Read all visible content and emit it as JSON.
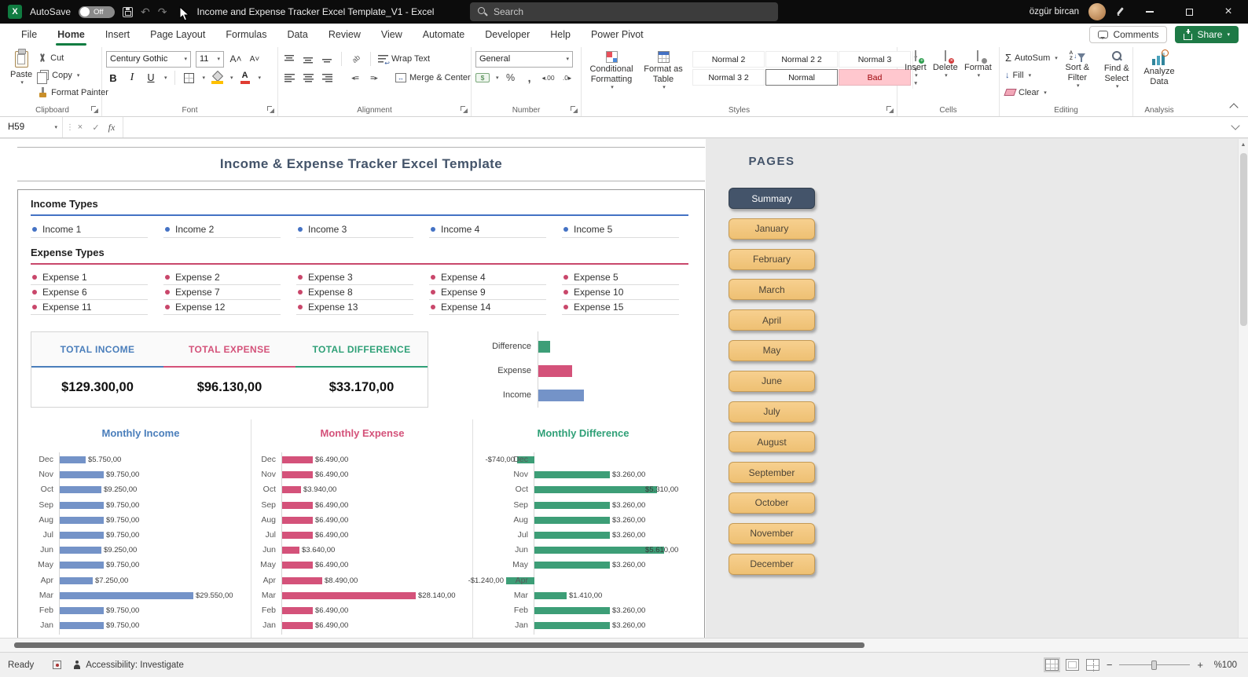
{
  "titlebar": {
    "autosave_label": "AutoSave",
    "autosave_state": "Off",
    "doc_title": "Income and Expense Tracker Excel Template_V1 - Excel",
    "search_placeholder": "Search",
    "user_name": "özgür bircan"
  },
  "icons": {
    "bold": "B",
    "italic": "I",
    "underline": "U",
    "autosum": "Σ",
    "percent": "%",
    "comma": ",",
    "inc_decimal": "◂.00",
    "dec_decimal": ".0▸"
  },
  "ribbon": {
    "tabs": [
      "File",
      "Home",
      "Insert",
      "Page Layout",
      "Formulas",
      "Data",
      "Review",
      "View",
      "Automate",
      "Developer",
      "Help",
      "Power Pivot"
    ],
    "active_tab": "Home",
    "comments_label": "Comments",
    "share_label": "Share",
    "groups": {
      "clipboard": {
        "label": "Clipboard",
        "paste": "Paste",
        "cut": "Cut",
        "copy": "Copy",
        "format_painter": "Format Painter"
      },
      "font": {
        "label": "Font",
        "font_name": "Century Gothic",
        "font_size": "11"
      },
      "alignment": {
        "label": "Alignment",
        "wrap_text": "Wrap Text",
        "merge_center": "Merge & Center"
      },
      "number": {
        "label": "Number",
        "format": "General"
      },
      "styles": {
        "label": "Styles",
        "conditional_formatting": "Conditional Formatting",
        "format_as_table": "Format as Table",
        "gallery": [
          {
            "name": "Normal 2",
            "kind": "plain"
          },
          {
            "name": "Normal 2 2",
            "kind": "plain"
          },
          {
            "name": "Normal 3",
            "kind": "plain"
          },
          {
            "name": "Normal 3 2",
            "kind": "plain"
          },
          {
            "name": "Normal",
            "kind": "selected"
          },
          {
            "name": "Bad",
            "kind": "bad"
          }
        ]
      },
      "cells": {
        "label": "Cells",
        "insert": "Insert",
        "delete": "Delete",
        "format": "Format"
      },
      "editing": {
        "label": "Editing",
        "autosum": "AutoSum",
        "fill": "Fill",
        "clear": "Clear",
        "sort_filter": "Sort & Filter",
        "find_select": "Find & Select"
      },
      "analysis": {
        "label": "Analysis",
        "analyze_data": "Analyze Data"
      }
    }
  },
  "formula_bar": {
    "name_box": "H59",
    "fx": "fx"
  },
  "sheet": {
    "page_title": "Income & Expense Tracker Excel Template",
    "income_heading": "Income Types",
    "income_types": [
      "Income 1",
      "Income 2",
      "Income 3",
      "Income 4",
      "Income 5"
    ],
    "expense_heading": "Expense Types",
    "expense_types": [
      "Expense 1",
      "Expense 2",
      "Expense 3",
      "Expense 4",
      "Expense 5",
      "Expense 6",
      "Expense 7",
      "Expense 8",
      "Expense 9",
      "Expense 10",
      "Expense 11",
      "Expense 12",
      "Expense 13",
      "Expense 14",
      "Expense 15"
    ],
    "summary": {
      "headers": [
        "TOTAL INCOME",
        "TOTAL EXPENSE",
        "TOTAL DIFFERENCE"
      ],
      "header_colors": [
        "#4A7EBB",
        "#D4527A",
        "#2FA077"
      ],
      "values": [
        "$129.300,00",
        "$96.130,00",
        "$33.170,00"
      ]
    }
  },
  "chart_data": [
    {
      "id": "totals",
      "type": "bar",
      "orientation": "horizontal",
      "title": "",
      "categories": [
        "Difference",
        "Expense",
        "Income"
      ],
      "values": [
        33170,
        96130,
        129300
      ],
      "colors": [
        "#3D9E77",
        "#D4527A",
        "#7493C8"
      ],
      "max": 129300,
      "grid": false,
      "legend": "none"
    },
    {
      "id": "monthly_income",
      "type": "bar",
      "orientation": "horizontal",
      "title": "Monthly Income",
      "title_color": "#4A7EBB",
      "color": "#7493C8",
      "categories": [
        "Dec",
        "Nov",
        "Oct",
        "Sep",
        "Aug",
        "Jul",
        "Jun",
        "May",
        "Apr",
        "Mar",
        "Feb",
        "Jan"
      ],
      "values": [
        5750,
        9750,
        9250,
        9750,
        9750,
        9750,
        9250,
        9750,
        7250,
        29550,
        9750,
        9750
      ],
      "value_labels": [
        "$5.750,00",
        "$9.750,00",
        "$9.250,00",
        "$9.750,00",
        "$9.750,00",
        "$9.750,00",
        "$9.250,00",
        "$9.750,00",
        "$7.250,00",
        "$29.550,00",
        "$9.750,00",
        "$9.750,00"
      ],
      "max": 29550,
      "xlim": [
        0,
        29550
      ],
      "grid": false,
      "legend": "none"
    },
    {
      "id": "monthly_expense",
      "type": "bar",
      "orientation": "horizontal",
      "title": "Monthly Expense",
      "title_color": "#D4527A",
      "color": "#D4527A",
      "categories": [
        "Dec",
        "Nov",
        "Oct",
        "Sep",
        "Aug",
        "Jul",
        "Jun",
        "May",
        "Apr",
        "Mar",
        "Feb",
        "Jan"
      ],
      "values": [
        6490,
        6490,
        3940,
        6490,
        6490,
        6490,
        3640,
        6490,
        8490,
        28140,
        6490,
        6490
      ],
      "value_labels": [
        "$6.490,00",
        "$6.490,00",
        "$3.940,00",
        "$6.490,00",
        "$6.490,00",
        "$6.490,00",
        "$3.640,00",
        "$6.490,00",
        "$8.490,00",
        "$28.140,00",
        "$6.490,00",
        "$6.490,00"
      ],
      "max": 28140,
      "xlim": [
        0,
        28140
      ],
      "grid": false,
      "legend": "none"
    },
    {
      "id": "monthly_difference",
      "type": "bar",
      "orientation": "horizontal",
      "title": "Monthly Difference",
      "title_color": "#2FA077",
      "color": "#3D9E77",
      "categories": [
        "Dec",
        "Nov",
        "Oct",
        "Sep",
        "Aug",
        "Jul",
        "Jun",
        "May",
        "Apr",
        "Mar",
        "Feb",
        "Jan"
      ],
      "values": [
        -740,
        3260,
        5310,
        3260,
        3260,
        3260,
        5610,
        3260,
        -1240,
        1410,
        3260,
        3260
      ],
      "value_labels": [
        "-$740,00",
        "$3.260,00",
        "$5.310,00",
        "$3.260,00",
        "$3.260,00",
        "$3.260,00",
        "$5.610,00",
        "$3.260,00",
        "-$1.240,00",
        "$1.410,00",
        "$3.260,00",
        "$3.260,00"
      ],
      "max": 5610,
      "xlim": [
        -1240,
        5610
      ],
      "grid": false,
      "legend": "none"
    }
  ],
  "pages": {
    "title": "PAGES",
    "active": "Summary",
    "items": [
      "Summary",
      "January",
      "February",
      "March",
      "April",
      "May",
      "June",
      "July",
      "August",
      "September",
      "October",
      "November",
      "December"
    ]
  },
  "status_bar": {
    "ready": "Ready",
    "accessibility": "Accessibility: Investigate",
    "zoom_level": "%100"
  },
  "colors": {
    "income": "#7493C8",
    "expense": "#D4527A",
    "difference": "#3D9E77",
    "accent_dark": "#44546A",
    "page_button": "#F3C87E",
    "excel_green": "#107C41"
  }
}
